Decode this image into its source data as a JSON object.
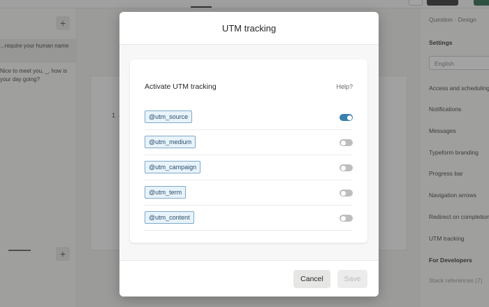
{
  "background": {
    "left_panel": {
      "questions": [
        {
          "text": "...require your human name"
        },
        {
          "text": "Nice to meet you, _, how is your day going?"
        }
      ]
    },
    "canvas": {
      "number": "1 →"
    },
    "right_panel": {
      "tabs": "Question · Design",
      "settings_heading": "Settings",
      "language_value": "English",
      "items": [
        "Access and scheduling",
        "Notifications",
        "Messages",
        "Typeform branding",
        "Progress bar",
        "Navigation arrows",
        "Redirect on completion",
        "UTM tracking"
      ],
      "developers_heading": "For Developers",
      "developers_item": "Stack references (7)"
    }
  },
  "modal": {
    "title": "UTM tracking",
    "card": {
      "title": "Activate UTM tracking",
      "help": "Help?",
      "params": [
        {
          "label": "@utm_source",
          "enabled": true
        },
        {
          "label": "@utm_medium",
          "enabled": false
        },
        {
          "label": "@utm_campaign",
          "enabled": false
        },
        {
          "label": "@utm_term",
          "enabled": false
        },
        {
          "label": "@utm_content",
          "enabled": false
        }
      ]
    },
    "footer": {
      "cancel_label": "Cancel",
      "save_label": "Save"
    }
  },
  "colors": {
    "toggle_on": "#3a7fb0",
    "toggle_off": "#bdbdbd",
    "tag_bg": "#e8f3fb",
    "tag_border": "#7fa9c9"
  }
}
